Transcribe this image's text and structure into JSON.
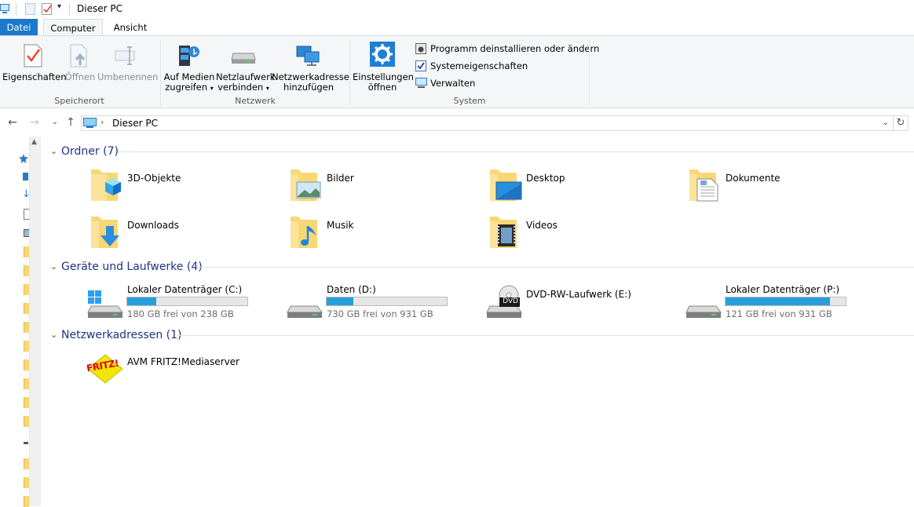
{
  "window": {
    "title": "Dieser PC"
  },
  "tabs": [
    {
      "label": "Datei"
    },
    {
      "label": "Computer"
    },
    {
      "label": "Ansicht"
    }
  ],
  "ribbon": {
    "groups": [
      {
        "label": "Speicherort"
      },
      {
        "label": "Netzwerk"
      },
      {
        "label": "System"
      }
    ],
    "buttons": {
      "properties": "Eigenschaften",
      "open": "Öffnen",
      "rename": "Umbenennen",
      "media_line1": "Auf Medien",
      "media_line2": "zugreifen",
      "netdrive_line1": "Netzlaufwerk",
      "netdrive_line2": "verbinden",
      "netaddr_line1": "Netzwerkadresse",
      "netaddr_line2": "hinzufügen",
      "settings_line1": "Einstellungen",
      "settings_line2": "öffnen",
      "uninstall": "Programm deinstallieren oder ändern",
      "sysprops": "Systemeigenschaften",
      "manage": "Verwalten"
    }
  },
  "address": {
    "path": "Dieser PC"
  },
  "sections": {
    "folders": {
      "header": "Ordner (7)",
      "items": [
        {
          "label": "3D-Objekte",
          "icon": "3d-objects-folder-icon"
        },
        {
          "label": "Bilder",
          "icon": "pictures-folder-icon"
        },
        {
          "label": "Desktop",
          "icon": "desktop-folder-icon"
        },
        {
          "label": "Dokumente",
          "icon": "documents-folder-icon"
        },
        {
          "label": "Downloads",
          "icon": "downloads-folder-icon"
        },
        {
          "label": "Musik",
          "icon": "music-folder-icon"
        },
        {
          "label": "Videos",
          "icon": "videos-folder-icon"
        }
      ]
    },
    "drives": {
      "header": "Geräte und Laufwerke (4)",
      "items": [
        {
          "label": "Lokaler Datenträger (C:)",
          "free": "180 GB frei von 238 GB",
          "used_fraction": 0.24
        },
        {
          "label": "Daten (D:)",
          "free": "730 GB frei von 931 GB",
          "used_fraction": 0.22
        },
        {
          "label": "DVD-RW-Laufwerk (E:)",
          "free": "",
          "badge": "DVD"
        },
        {
          "label": "Lokaler Datenträger (P:)",
          "free": "121 GB frei von 931 GB",
          "used_fraction": 0.87
        }
      ]
    },
    "network": {
      "header": "Netzwerkadressen (1)",
      "items": [
        {
          "label": "AVM FRITZ!Mediaserver",
          "logo_text": "FRITZ!"
        }
      ]
    }
  },
  "colors": {
    "accent": "#1979ca",
    "bar_fill": "#26a0da",
    "header_text": "#1e3287"
  }
}
